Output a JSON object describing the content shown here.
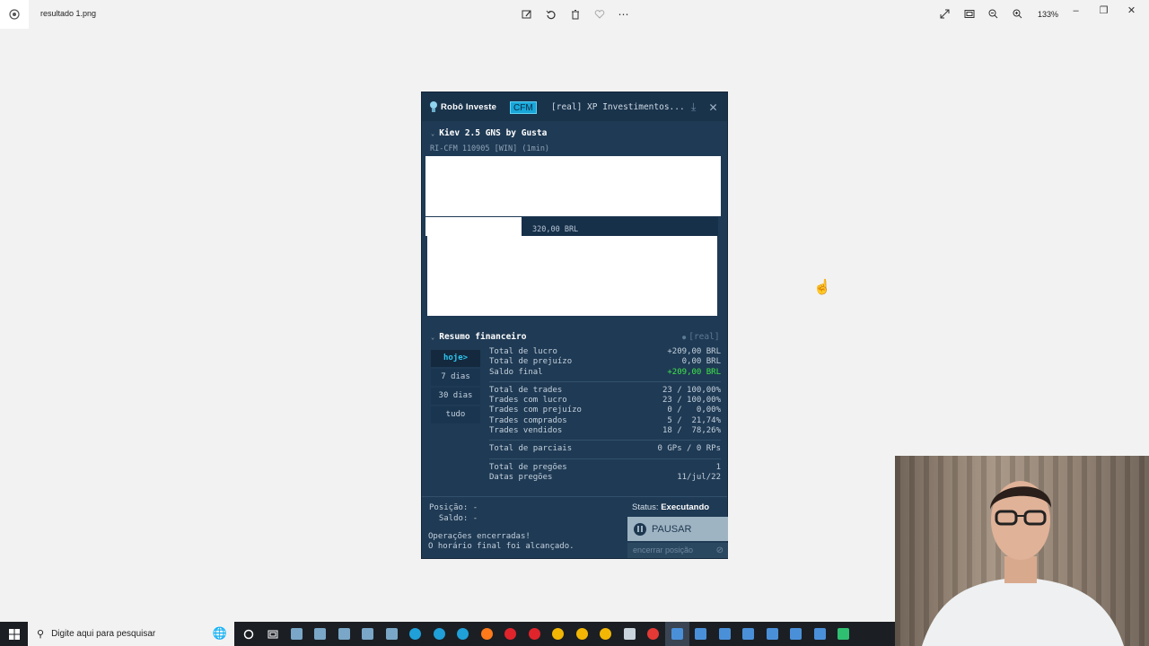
{
  "window": {
    "file_name": "resultado 1.png",
    "zoom": "133%",
    "toolbar_icons": [
      "edit-icon",
      "rotate-icon",
      "delete-icon",
      "favorite-icon",
      "more-icon"
    ],
    "right_icons": [
      "fullscreen-icon",
      "fit-icon",
      "zoom-out-icon",
      "zoom-in-icon"
    ]
  },
  "panel": {
    "brand": "Robô Investe",
    "tag": "CFM",
    "account": "[real] XP Investimentos...",
    "strategy_title": "Kiev 2.5 GNS by Gusta",
    "strategy_sub": "RI-CFM 110905 [WIN] (1min)",
    "price_label": "320,00 BRL",
    "summary": {
      "title": "Resumo financeiro",
      "mode": "[real]",
      "periods": [
        {
          "label": "hoje>",
          "active": true
        },
        {
          "label": "7 dias",
          "active": false
        },
        {
          "label": "30 dias",
          "active": false
        },
        {
          "label": "tudo",
          "active": false
        }
      ],
      "group1": [
        {
          "label": "Total de lucro",
          "value": "+209,00 BRL"
        },
        {
          "label": "Total de prejuízo",
          "value": "0,00 BRL"
        },
        {
          "label": "Saldo final",
          "value": "+209,00 BRL",
          "highlight": true
        }
      ],
      "group2": [
        {
          "label": "Total de trades",
          "value": "23 / 100,00%"
        },
        {
          "label": "Trades com lucro",
          "value": "23 / 100,00%"
        },
        {
          "label": "Trades com prejuízo",
          "value": "0 /   0,00%"
        },
        {
          "label": "Trades comprados",
          "value": "5 /  21,74%"
        },
        {
          "label": "Trades vendidos",
          "value": "18 /  78,26%"
        }
      ],
      "group3": [
        {
          "label": "Total de parciais",
          "value": "0 GPs / 0 RPs"
        }
      ],
      "group4": [
        {
          "label": "Total de pregões",
          "value": "1"
        },
        {
          "label": "Datas pregões",
          "value": "11/jul/22"
        }
      ]
    },
    "position_label": "Posição: -",
    "balance_label": "Saldo: -",
    "status_label": "Status:",
    "status_value": "Executando",
    "pause_label": "PAUSAR",
    "end_position_label": "encerrar posição",
    "message_line1": "Operações encerradas!",
    "message_line2": "O horário final foi alcançado."
  },
  "taskbar": {
    "search_placeholder": "Digite aqui para pesquisar",
    "icons": [
      {
        "name": "cortana-icon",
        "color": "#ffffff"
      },
      {
        "name": "task-view-icon",
        "color": "#ffffff"
      },
      {
        "name": "app-icon",
        "color": "#7aa7c7"
      },
      {
        "name": "app-icon",
        "color": "#7aa7c7"
      },
      {
        "name": "app-icon",
        "color": "#7aa7c7"
      },
      {
        "name": "app-icon",
        "color": "#7aa7c7"
      },
      {
        "name": "app-icon",
        "color": "#7aa7c7"
      },
      {
        "name": "edge-icon",
        "color": "#1fa0d8"
      },
      {
        "name": "edge-icon",
        "color": "#1fa0d8"
      },
      {
        "name": "edge-icon",
        "color": "#1fa0d8"
      },
      {
        "name": "firefox-icon",
        "color": "#ff7a1a"
      },
      {
        "name": "opera-icon",
        "color": "#e0242b"
      },
      {
        "name": "opera-icon",
        "color": "#e0242b"
      },
      {
        "name": "chrome-icon",
        "color": "#f2b705"
      },
      {
        "name": "chrome-icon",
        "color": "#f2b705"
      },
      {
        "name": "chrome-icon",
        "color": "#f2b705"
      },
      {
        "name": "mail-icon",
        "color": "#c9d4dc"
      },
      {
        "name": "vivaldi-icon",
        "color": "#e53935"
      },
      {
        "name": "photos-icon",
        "color": "#4a90d9"
      },
      {
        "name": "window-icon",
        "color": "#4a90d9"
      },
      {
        "name": "window-icon",
        "color": "#4a90d9"
      },
      {
        "name": "window-icon",
        "color": "#4a90d9"
      },
      {
        "name": "window-icon",
        "color": "#4a90d9"
      },
      {
        "name": "window-icon",
        "color": "#4a90d9"
      },
      {
        "name": "window-icon",
        "color": "#4a90d9"
      },
      {
        "name": "drive-icon",
        "color": "#2fbf71"
      }
    ]
  }
}
